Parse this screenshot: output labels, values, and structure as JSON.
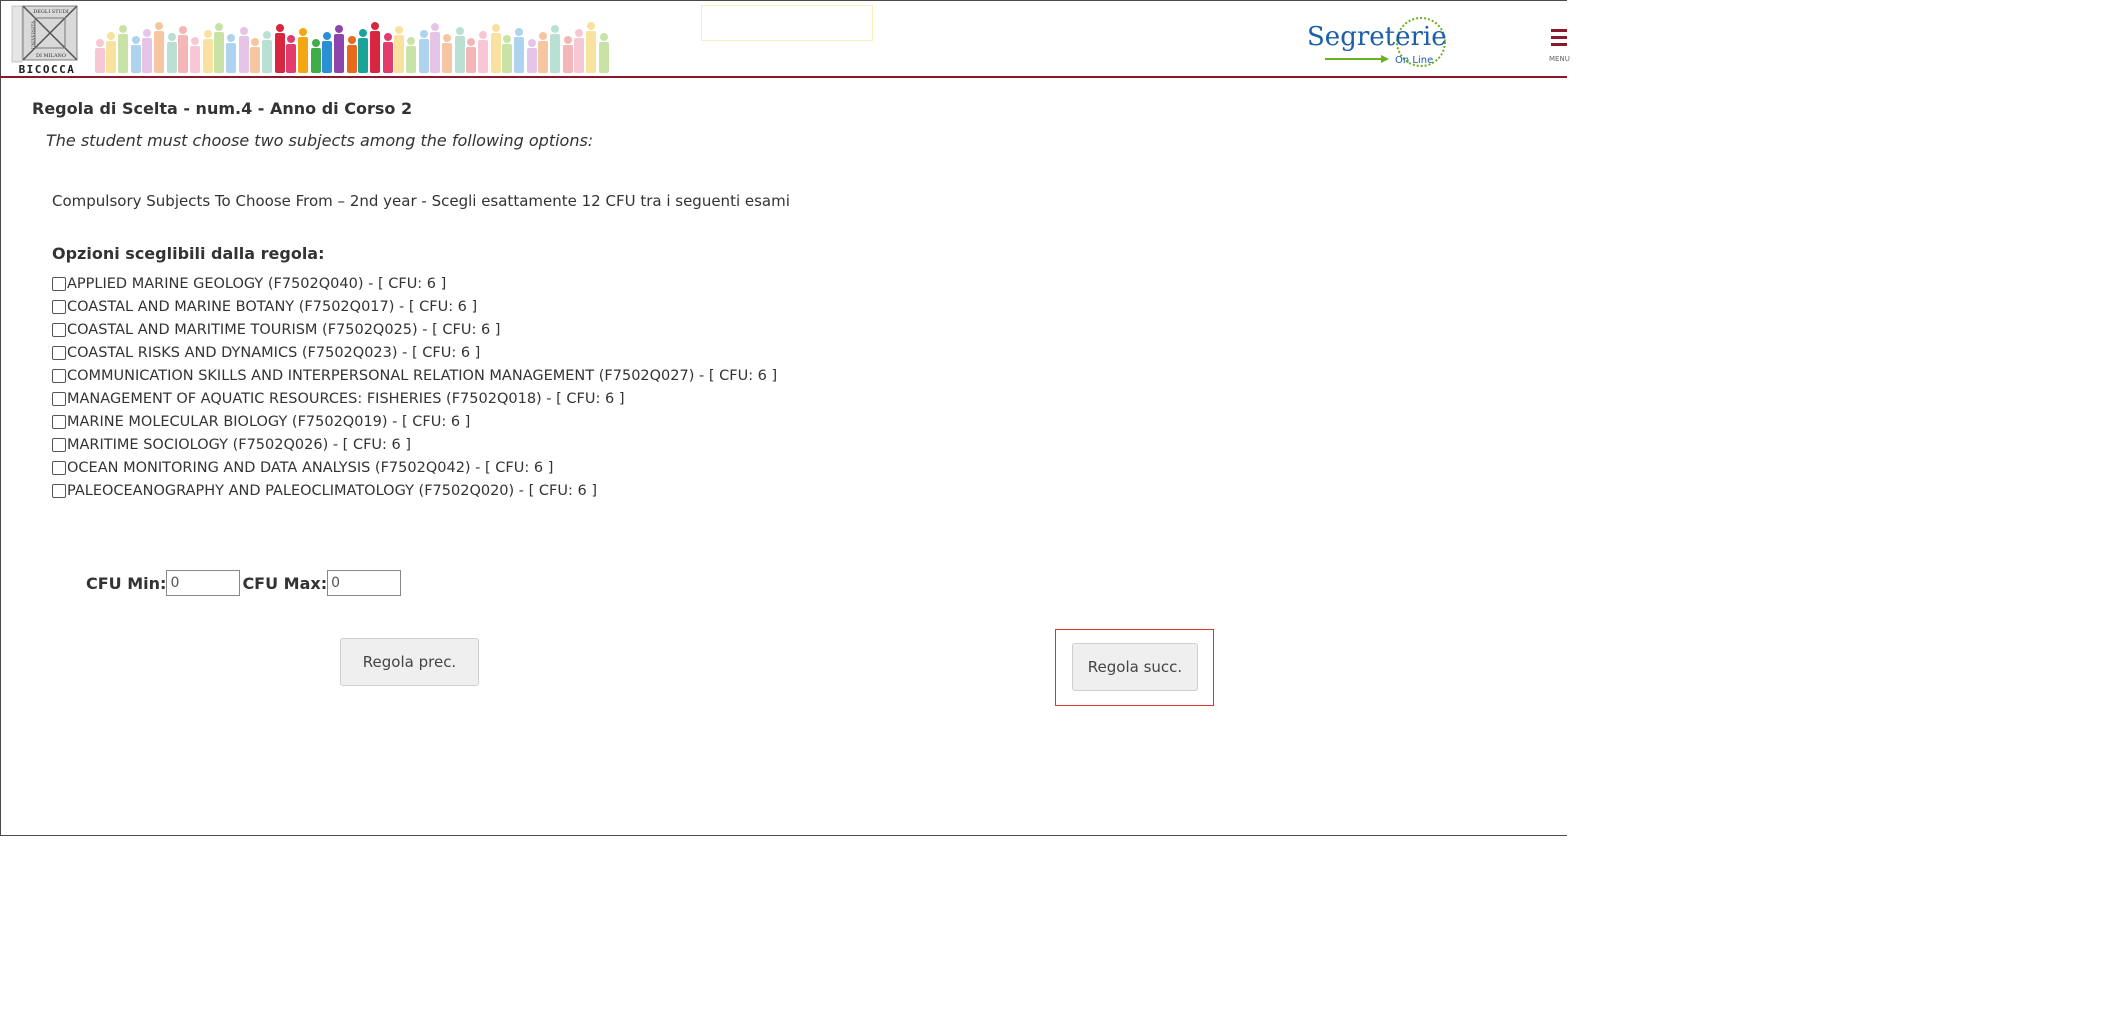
{
  "header": {
    "university_logo_text": [
      "UNIVERSITÀ",
      "DEGLI STUDI",
      "DI MILANO",
      "BICOCCA"
    ],
    "portal_logo_text": [
      "Segreterie",
      "On Line"
    ],
    "menu_label": "MENU"
  },
  "rule": {
    "title": "Regola di Scelta - num.4 - Anno di Corso 2",
    "description": "The student must choose two subjects among the following options:",
    "info": "Compulsory Subjects To Choose From – 2nd year - Scegli esattamente 12 CFU tra i seguenti esami"
  },
  "options": {
    "heading": "Opzioni sceglibili dalla regola:",
    "items": [
      {
        "label": "APPLIED MARINE GEOLOGY (F7502Q040) - [ CFU: 6 ]",
        "checked": false
      },
      {
        "label": "COASTAL AND MARINE BOTANY (F7502Q017) - [ CFU: 6 ]",
        "checked": false
      },
      {
        "label": "COASTAL AND MARITIME TOURISM (F7502Q025) - [ CFU: 6 ]",
        "checked": false
      },
      {
        "label": "COASTAL RISKS AND DYNAMICS (F7502Q023) - [ CFU: 6 ]",
        "checked": false
      },
      {
        "label": "COMMUNICATION SKILLS AND INTERPERSONAL RELATION MANAGEMENT (F7502Q027) - [ CFU: 6 ]",
        "checked": false
      },
      {
        "label": "MANAGEMENT OF AQUATIC RESOURCES: FISHERIES (F7502Q018) - [ CFU: 6 ]",
        "checked": false
      },
      {
        "label": "MARINE MOLECULAR BIOLOGY (F7502Q019) - [ CFU: 6 ]",
        "checked": false
      },
      {
        "label": "MARITIME SOCIOLOGY (F7502Q026) - [ CFU: 6 ]",
        "checked": false
      },
      {
        "label": "OCEAN MONITORING AND DATA ANALYSIS (F7502Q042) - [ CFU: 6 ]",
        "checked": false
      },
      {
        "label": "PALEOCEANOGRAPHY AND PALEOCLIMATOLOGY (F7502Q020) - [ CFU: 6 ]",
        "checked": false
      }
    ]
  },
  "cfu": {
    "min_label": "CFU Min:",
    "min_value": "0",
    "max_label": "CFU Max:",
    "max_value": "0"
  },
  "nav": {
    "prev_label": "Regola prec.",
    "next_label": "Regola succ."
  },
  "colors": {
    "brand_red": "#8a1a2b",
    "highlight": "#e03030",
    "portal_blue": "#1a5fa8",
    "portal_green": "#6ab023"
  }
}
